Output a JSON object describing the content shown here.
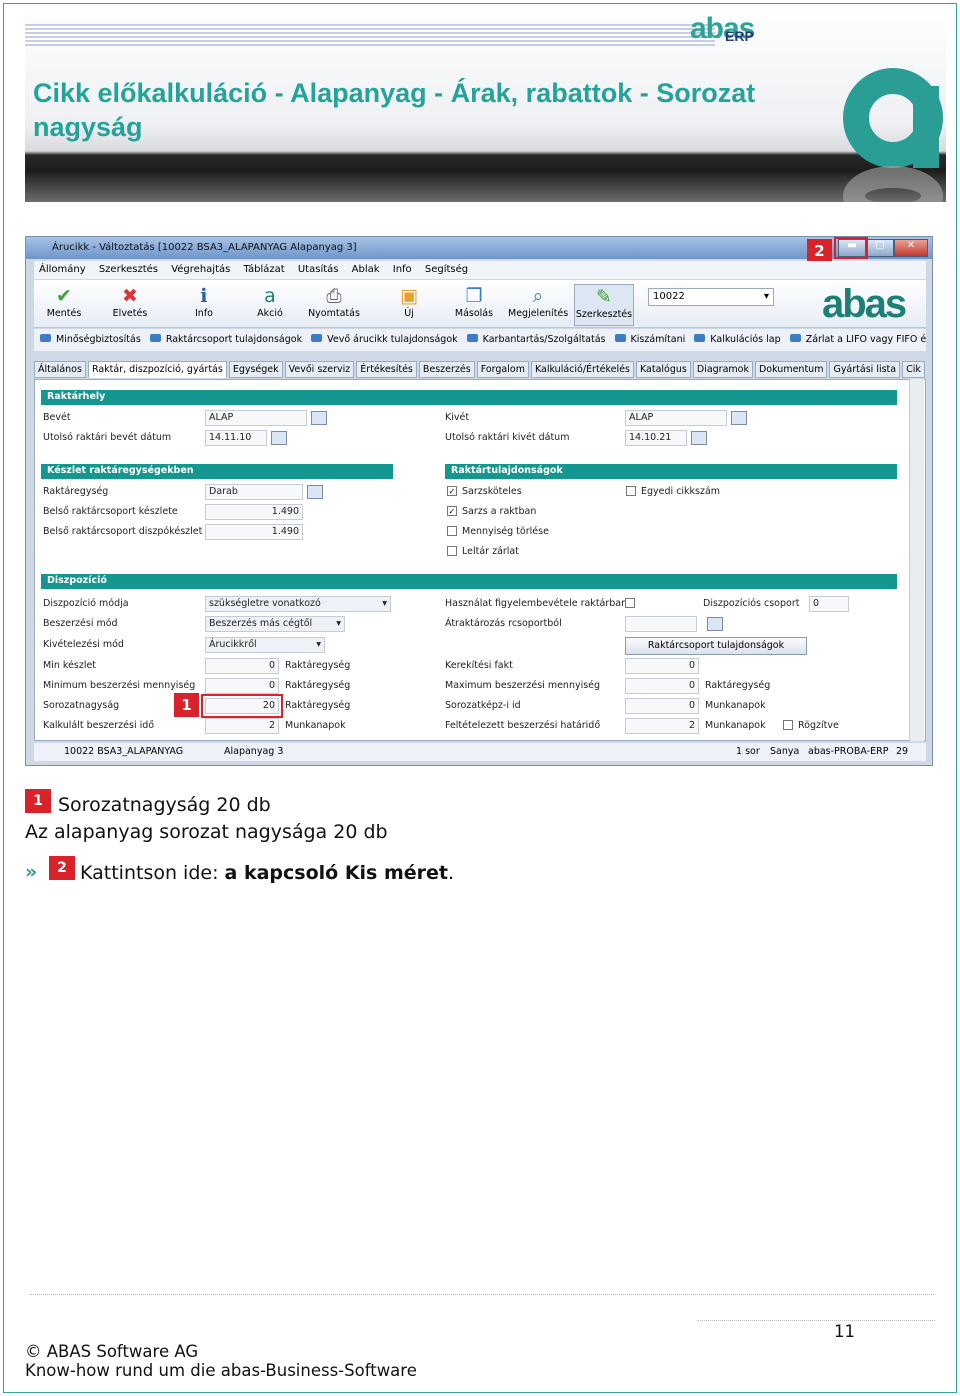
{
  "banner": {
    "title": "Cikk előkalkuláció - Alapanyag - Árak, rabattok - Sorozat nagyság",
    "logo_top": "abas",
    "logo_erp": "ERP"
  },
  "window": {
    "title": "Árucikk - Változtatás  [10022  BSA3_ALAPANYAG  Alapanyag 3]"
  },
  "menu": [
    "Állomány",
    "Szerkesztés",
    "Végrehajtás",
    "Táblázat",
    "Utasítás",
    "Ablak",
    "Info",
    "Segítség"
  ],
  "toolbar": {
    "buttons": [
      "Mentés",
      "Elvetés",
      "Info",
      "Akció",
      "Nyomtatás",
      "Új",
      "Másolás",
      "Megjelenítés",
      "Szerkesztés"
    ],
    "combo": "10022",
    "brand": "abas"
  },
  "links": [
    "Minőségbiztosítás",
    "Raktárcsoport tulajdonságok",
    "Vevő árucikk tulajdonságok",
    "Karbantartás/Szolgáltatás",
    "Kiszámítani",
    "Kalkulációs lap",
    "Zárlat a LIFO vagy FIFO érté..."
  ],
  "tabs": [
    "Általános",
    "Raktár, diszpozíció, gyártás",
    "Egységek",
    "Vevői szerviz",
    "Értékesítés",
    "Beszerzés",
    "Forgalom",
    "Kalkuláció/Értékelés",
    "Katalógus",
    "Diagramok",
    "Dokumentum",
    "Gyártási lista",
    "Cik"
  ],
  "raktarhely": {
    "header": "Raktárhely",
    "bevet_label": "Bevét",
    "bevet": "ALAP",
    "utolso_bevet_label": "Utolsó raktári bevét dátum",
    "utolso_bevet": "14.11.10",
    "kivet_label": "Kivét",
    "kivet": "ALAP",
    "utolso_kivet_label": "Utolsó raktári kivét dátum",
    "utolso_kivet": "14.10.21"
  },
  "keszlet": {
    "header": "Készlet raktáregységekben",
    "raktaregyseg_label": "Raktáregység",
    "raktaregyseg": "Darab",
    "belso_label": "Belső raktárcsoport készlete",
    "belso": "1.490",
    "disp_label": "Belső raktárcsoport diszpókészlet",
    "disp": "1.490"
  },
  "raktartul": {
    "header": "Raktártulajdonságok",
    "sarzs": "Sarzsköteles",
    "sarzs_rakt": "Sarzs a raktban",
    "menny": "Mennyiség törlése",
    "leltar": "Leltár zárlat",
    "egyedi": "Egyedi cikkszám"
  },
  "disp": {
    "header": "Diszpozíció",
    "mod_label": "Diszpozíció módja",
    "mod": "szükségletre vonatkozó",
    "besz_label": "Beszerzési mód",
    "besz": "Beszerzés más cégtől",
    "kiv_label": "Kivételezési mód",
    "kiv": "Árucikkről",
    "min_label": "Min készlet",
    "min": "0",
    "min_unit": "Raktáregység",
    "minb_label": "Minimum beszerzési mennyiség",
    "minb": "0",
    "minb_unit": "Raktáregység",
    "soroz_label": "Sorozatnagyság",
    "soroz": "20",
    "soroz_unit": "Raktáregység",
    "kalk_label": "Kalkulált beszerzési idő",
    "kalk": "2",
    "kalk_unit": "Munkanapok",
    "haszn_label": "Használat figyelembevétele raktárban",
    "dcs_label": "Diszpozíciós csoport",
    "dcs": "0",
    "atrak_label": "Átraktározás rcsoportból",
    "rcs_btn": "Raktárcsoport tulajdonságok",
    "ker_label": "Kerekítési fakt",
    "ker": "0",
    "maxb_label": "Maximum beszerzési mennyiség",
    "maxb": "0",
    "maxb_unit": "Raktáregység",
    "sorkep_label": "Sorozatképz-i id",
    "sorkep": "0",
    "sorkep_unit": "Munkanapok",
    "felt_label": "Feltételezett beszerzési határidő",
    "felt": "2",
    "felt_unit": "Munkanapok",
    "rogzitve": "Rögzítve"
  },
  "status": {
    "left": "10022 BSA3_ALAPANYAG",
    "mid": "Alapanyag 3",
    "sor": "1 sor",
    "user": "Sanya",
    "server": "abas-PROBA-ERP",
    "num": "29"
  },
  "markers": {
    "m1": "1",
    "m2": "2"
  },
  "text": {
    "line1": "Sorozatnagyság 20 db",
    "line2": "Az alapanyag sorozat nagysága 20 db",
    "bullet": "»",
    "click": "Kattintson ide: ",
    "bold": "a kapcsoló Kis méret",
    "end": "."
  },
  "footer": {
    "page": "11",
    "company": "© ABAS Software AG",
    "slogan": "Know-how rund um die abas-Business-Software"
  }
}
